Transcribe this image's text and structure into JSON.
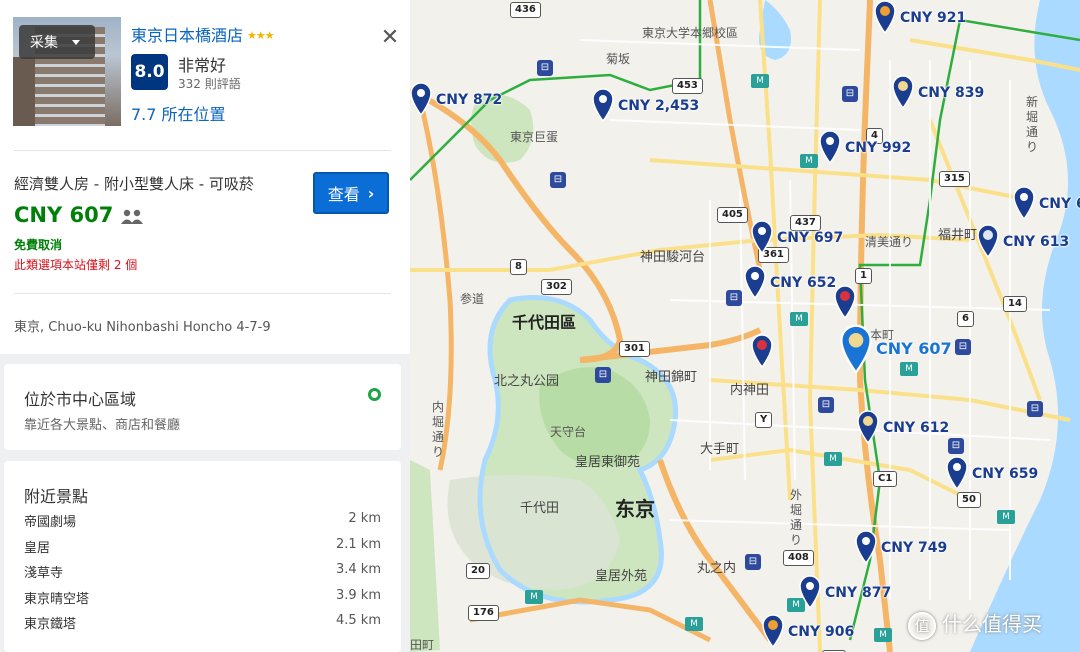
{
  "hotel": {
    "collect_label": "采集",
    "name": "東京日本橋酒店",
    "stars": "★★★",
    "score": "8.0",
    "score_label": "非常好",
    "review_count": "332 則評語",
    "location_score": "7.7 所在位置",
    "room_type": "經濟雙人房 - 附小型雙人床 - 可吸菸",
    "price": "CNY 607",
    "view_button": "查看",
    "free_cancel": "免費取消",
    "rooms_left": "此類選項本站僅剩 2 個",
    "address": "東京, Chuo-ku Nihonbashi Honcho 4-7-9"
  },
  "center": {
    "title": "位於市中心區域",
    "description": "靠近各大景點、商店和餐廳"
  },
  "attractions": {
    "title": "附近景點",
    "items": [
      {
        "name": "帝國劇場",
        "distance": "2 km"
      },
      {
        "name": "皇居",
        "distance": "2.1 km"
      },
      {
        "name": "淺草寺",
        "distance": "3.4 km"
      },
      {
        "name": "東京晴空塔",
        "distance": "3.9 km"
      },
      {
        "name": "東京鐵塔",
        "distance": "4.5 km"
      }
    ]
  },
  "map": {
    "labels": {
      "chiyoda_ku": "千代田區",
      "tokyo": "东京",
      "chiyoda": "千代田",
      "kitanomaru": "北之丸公园",
      "tenshudai": "天守台",
      "kokyo_higashi": "皇居東御苑",
      "kokyo_gaien": "皇居外苑",
      "kanda_surugadai": "神田駿河台",
      "kanda_nishikicho": "神田錦町",
      "uchikanda": "内神田",
      "otemachi": "大手町",
      "marunouchi": "丸之内",
      "todai_hongo": "東京大学本郷校區",
      "tokyo_dome": "東京巨蛋",
      "kiyosumi": "清美通り",
      "fukui": "福井町",
      "shinbori": "新堀通り",
      "sando": "参道",
      "uchibori": "内堀通り",
      "sotobori": "外堀通り",
      "honcho": "本町",
      "kikuzaka": "菊坂",
      "toda": "田町"
    },
    "shields": [
      "436",
      "453",
      "405",
      "437",
      "315",
      "8",
      "302",
      "301",
      "4",
      "6",
      "14",
      "50",
      "408",
      "20",
      "176",
      "Y",
      "C1",
      "C1",
      "1",
      "361"
    ],
    "prices": [
      {
        "label": "CNY 921",
        "color": "#f0a030"
      },
      {
        "label": "CNY 872",
        "color": "#1a3d8f"
      },
      {
        "label": "CNY 2,453",
        "color": "#1a3d8f"
      },
      {
        "label": "CNY 839",
        "color": "#1a3d8f"
      },
      {
        "label": "CNY 992",
        "color": "#1a3d8f"
      },
      {
        "label": "CNY 6",
        "color": "#1a3d8f"
      },
      {
        "label": "CNY 697",
        "color": "#1a3d8f"
      },
      {
        "label": "CNY 613",
        "color": "#1a3d8f"
      },
      {
        "label": "CNY 652",
        "color": "#1a3d8f"
      },
      {
        "label": "",
        "color": "#d9323b"
      },
      {
        "label": "CNY 607",
        "color": "#1a74d6"
      },
      {
        "label": "",
        "color": "#d9323b"
      },
      {
        "label": "CNY 612",
        "color": "#1a3d8f"
      },
      {
        "label": "CNY 659",
        "color": "#1a3d8f"
      },
      {
        "label": "CNY 749",
        "color": "#1a3d8f"
      },
      {
        "label": "CNY 877",
        "color": "#1a3d8f"
      },
      {
        "label": "CNY 906",
        "color": "#f0a030"
      }
    ],
    "watermark": "什么值得买"
  },
  "colors": {
    "link": "#0b64c0",
    "score_bg": "#003580",
    "price_green": "#008009",
    "alert_red": "#d4111e",
    "button_blue": "#0b6dd6",
    "pin_navy": "#1a3d8f",
    "pin_selected": "#1a74d6"
  },
  "icons": [
    "caret-down-icon",
    "close-icon",
    "guests-icon",
    "chevron-right-icon",
    "green-dot-icon",
    "map-pin-icon",
    "train-icon",
    "metro-icon"
  ]
}
